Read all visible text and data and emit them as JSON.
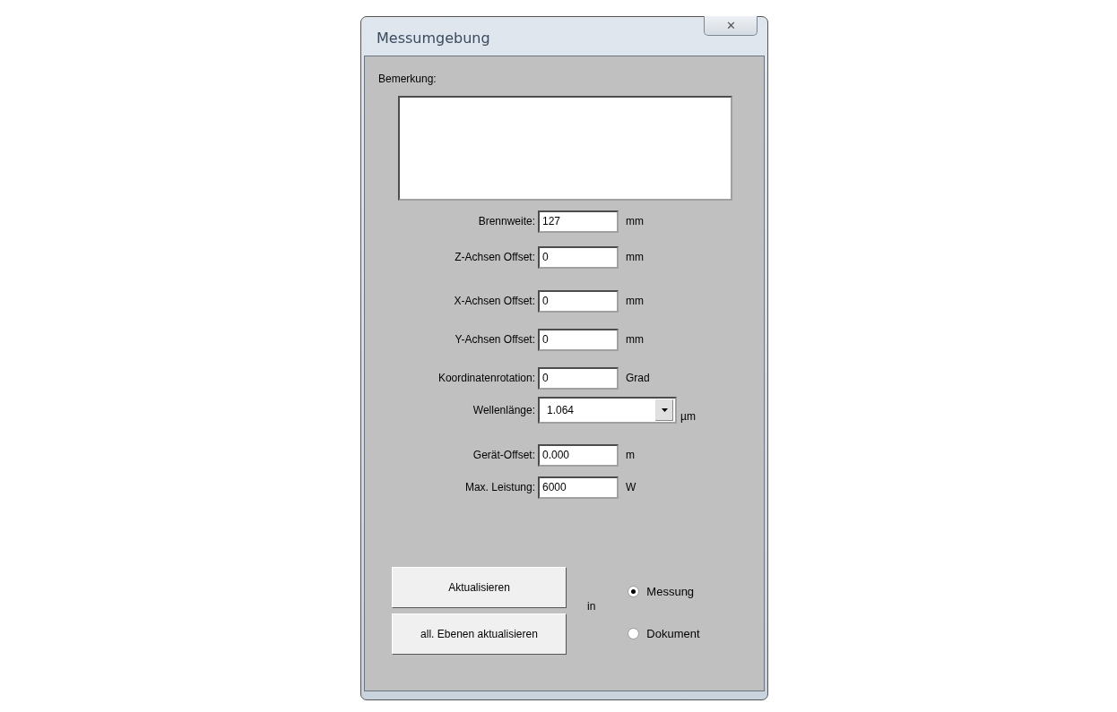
{
  "window": {
    "title": "Messumgebung",
    "close": "✕"
  },
  "remark": {
    "label": "Bemerkung:"
  },
  "fields": [
    {
      "kind": "text",
      "label": "Brennweite:",
      "value": "127",
      "unit": "mm"
    },
    {
      "kind": "text",
      "label": "Z-Achsen Offset:",
      "value": "0",
      "unit": "mm"
    },
    {
      "kind": "text",
      "label": "X-Achsen Offset:",
      "value": "0",
      "unit": "mm"
    },
    {
      "kind": "text",
      "label": "Y-Achsen Offset:",
      "value": "0",
      "unit": "mm"
    },
    {
      "kind": "text",
      "label": "Koordinatenrotation:",
      "value": "0",
      "unit": "Grad"
    },
    {
      "kind": "combo",
      "label": "Wellenlänge:",
      "value": "1.064",
      "unit": "µm"
    },
    {
      "kind": "text",
      "label": "Gerät-Offset:",
      "value": "0.000",
      "unit": "m"
    },
    {
      "kind": "text",
      "label": "Max. Leistung:",
      "value": "6000",
      "unit": "W"
    }
  ],
  "buttons": [
    "Aktualisieren",
    "all. Ebenen aktualisieren"
  ],
  "in_label": "in",
  "target": [
    {
      "label": "Messung",
      "selected": true
    },
    {
      "label": "Dokument",
      "selected": false
    }
  ]
}
